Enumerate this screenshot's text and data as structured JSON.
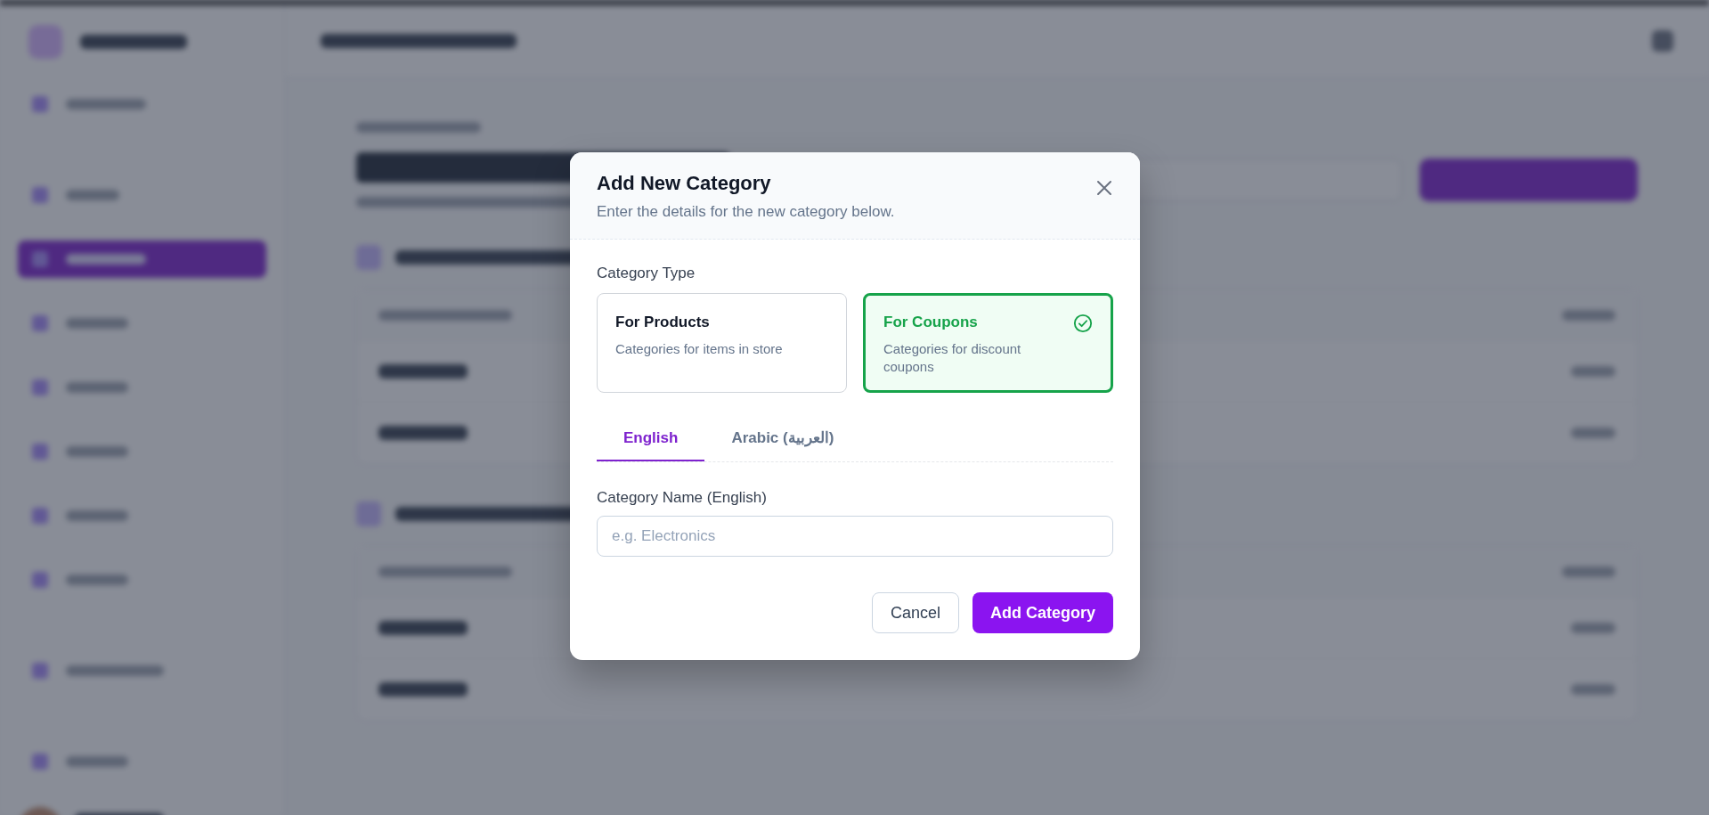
{
  "dialog": {
    "title": "Add New Category",
    "subtitle": "Enter the details for the new category below.",
    "type_label": "Category Type",
    "type_options": [
      {
        "title": "For Products",
        "description": "Categories for items in store",
        "selected": false
      },
      {
        "title": "For Coupons",
        "description": "Categories for discount coupons",
        "selected": true
      }
    ],
    "language_tabs": [
      {
        "label": "English",
        "selected": true
      },
      {
        "label": "Arabic (العربية)",
        "selected": false
      }
    ],
    "name_field": {
      "label": "Category Name (English)",
      "placeholder": "e.g. Electronics"
    },
    "buttons": [
      {
        "label": "Cancel",
        "kind": "secondary"
      },
      {
        "label": "Add Category",
        "kind": "primary"
      }
    ]
  }
}
